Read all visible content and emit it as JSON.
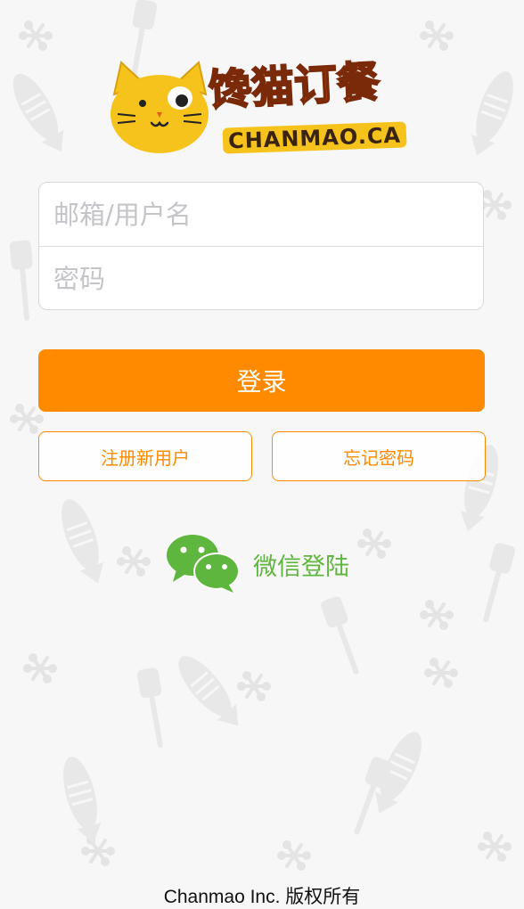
{
  "brand": {
    "title": "馋猫订餐",
    "domain": "CHANMAO.CA"
  },
  "login_form": {
    "username_placeholder": "邮箱/用户名",
    "password_placeholder": "密码",
    "username_value": "",
    "password_value": ""
  },
  "actions": {
    "login_label": "登录",
    "register_label": "注册新用户",
    "forgot_label": "忘记密码",
    "wechat_label": "微信登陆"
  },
  "footer": {
    "copyright": "Chanmao Inc. 版权所有"
  },
  "colors": {
    "accent": "#ff8a00",
    "wechat_green": "#5fb63f",
    "background": "#f7f7f7",
    "pattern": "#e6e6e6"
  },
  "icons": {
    "logo": "cat-face-icon",
    "wechat": "wechat-icon"
  }
}
